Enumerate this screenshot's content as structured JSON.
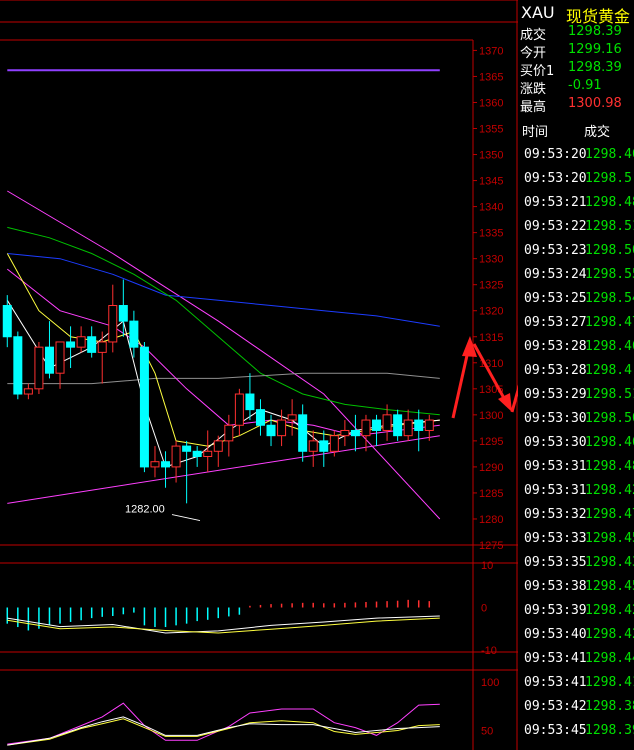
{
  "header": {
    "symbol": "XAU",
    "name": "现货黄金"
  },
  "quote": [
    {
      "label": "成交",
      "value": "1298.39",
      "color": "#00e000"
    },
    {
      "label": "今开",
      "value": "1299.16",
      "color": "#00e000"
    },
    {
      "label": "买价1",
      "value": "1298.39",
      "color": "#00e000"
    },
    {
      "label": "涨跌",
      "value": "-0.91",
      "color": "#00e000"
    },
    {
      "label": "最高",
      "value": "1300.98",
      "color": "#ff3030"
    }
  ],
  "ticks_header": {
    "time": "时间",
    "price": "成交"
  },
  "ticks": [
    {
      "time": "09:53:20",
      "price": "1298.46"
    },
    {
      "time": "09:53:20",
      "price": "1298.5"
    },
    {
      "time": "09:53:21",
      "price": "1298.48"
    },
    {
      "time": "09:53:22",
      "price": "1298.51"
    },
    {
      "time": "09:53:23",
      "price": "1298.50"
    },
    {
      "time": "09:53:24",
      "price": "1298.55"
    },
    {
      "time": "09:53:25",
      "price": "1298.54"
    },
    {
      "time": "09:53:27",
      "price": "1298.47"
    },
    {
      "time": "09:53:28",
      "price": "1298.46"
    },
    {
      "time": "09:53:28",
      "price": "1298.4"
    },
    {
      "time": "09:53:29",
      "price": "1298.51"
    },
    {
      "time": "09:53:30",
      "price": "1298.50"
    },
    {
      "time": "09:53:30",
      "price": "1298.46"
    },
    {
      "time": "09:53:31",
      "price": "1298.48"
    },
    {
      "time": "09:53:31",
      "price": "1298.42"
    },
    {
      "time": "09:53:32",
      "price": "1298.47"
    },
    {
      "time": "09:53:33",
      "price": "1298.45"
    },
    {
      "time": "09:53:35",
      "price": "1298.43"
    },
    {
      "time": "09:53:38",
      "price": "1298.45"
    },
    {
      "time": "09:53:39",
      "price": "1298.42"
    },
    {
      "time": "09:53:40",
      "price": "1298.42"
    },
    {
      "time": "09:53:41",
      "price": "1298.44"
    },
    {
      "time": "09:53:41",
      "price": "1298.41"
    },
    {
      "time": "09:53:42",
      "price": "1298.38"
    },
    {
      "time": "09:53:45",
      "price": "1298.39"
    }
  ],
  "colors": {
    "up": "#ff3030",
    "down": "#00ffff",
    "grid": "#c00000",
    "axis_text": "#c00000"
  },
  "chart_data": [
    {
      "type": "candlestick",
      "name": "price",
      "ylim": [
        1275,
        1372
      ],
      "yticks": [
        1275,
        1280,
        1285,
        1290,
        1295,
        1300,
        1305,
        1310,
        1315,
        1320,
        1325,
        1330,
        1335,
        1340,
        1345,
        1350,
        1355,
        1360,
        1365,
        1370
      ],
      "annotations": [
        {
          "text": "1282.00",
          "price": 1282
        }
      ],
      "candles": [
        [
          1321,
          1323,
          1313,
          1315
        ],
        [
          1315,
          1316,
          1303,
          1304
        ],
        [
          1304,
          1306,
          1303,
          1305
        ],
        [
          1305,
          1314,
          1304,
          1313
        ],
        [
          1313,
          1318,
          1307,
          1308
        ],
        [
          1308,
          1314,
          1305,
          1314
        ],
        [
          1314,
          1317,
          1309,
          1313
        ],
        [
          1313,
          1317,
          1312,
          1315
        ],
        [
          1315,
          1317,
          1311,
          1312
        ],
        [
          1312,
          1316,
          1306,
          1314
        ],
        [
          1314,
          1325,
          1312,
          1321
        ],
        [
          1321,
          1326,
          1315,
          1318
        ],
        [
          1318,
          1320,
          1311,
          1313
        ],
        [
          1313,
          1314,
          1289,
          1290
        ],
        [
          1290,
          1294,
          1288,
          1291
        ],
        [
          1291,
          1293,
          1286,
          1290
        ],
        [
          1290,
          1295,
          1287,
          1294
        ],
        [
          1294,
          1295,
          1283,
          1293
        ],
        [
          1293,
          1294,
          1290,
          1292
        ],
        [
          1292,
          1297,
          1289,
          1293
        ],
        [
          1293,
          1296,
          1290,
          1295
        ],
        [
          1295,
          1300,
          1292,
          1298
        ],
        [
          1298,
          1305,
          1296,
          1304
        ],
        [
          1304,
          1308,
          1299,
          1301
        ],
        [
          1301,
          1303,
          1296,
          1298
        ],
        [
          1298,
          1300,
          1294,
          1296
        ],
        [
          1296,
          1301,
          1294,
          1299
        ],
        [
          1299,
          1303,
          1296,
          1300
        ],
        [
          1300,
          1302,
          1291,
          1293
        ],
        [
          1293,
          1297,
          1290,
          1295
        ],
        [
          1295,
          1297,
          1290,
          1293
        ],
        [
          1293,
          1297,
          1292,
          1296
        ],
        [
          1296,
          1299,
          1294,
          1297
        ],
        [
          1297,
          1300,
          1293,
          1296
        ],
        [
          1296,
          1300,
          1293,
          1299
        ],
        [
          1299,
          1300,
          1294,
          1297
        ],
        [
          1297,
          1302,
          1295,
          1300
        ],
        [
          1300,
          1301,
          1295,
          1296
        ],
        [
          1296,
          1301,
          1295,
          1299
        ],
        [
          1299,
          1301,
          1293,
          1297
        ],
        [
          1297,
          1300,
          1295,
          1299
        ]
      ],
      "lines": [
        {
          "color": "#9040ff",
          "points": [
            [
              0,
              1366.2
            ],
            [
              41,
              1366.2
            ]
          ]
        },
        {
          "color": "#ff40ff",
          "points": [
            [
              0,
              1283
            ],
            [
              41,
              1296
            ]
          ]
        },
        {
          "color": "#ff40ff",
          "points": [
            [
              0,
              1343
            ],
            [
              10,
              1331
            ],
            [
              20,
              1318
            ],
            [
              30,
              1304
            ],
            [
              41,
              1280
            ]
          ]
        },
        {
          "color": "#1c3cff",
          "points": [
            [
              0,
              1331
            ],
            [
              5,
              1330
            ],
            [
              10,
              1327
            ],
            [
              15,
              1323
            ],
            [
              20,
              1322
            ],
            [
              25,
              1321
            ],
            [
              30,
              1320
            ],
            [
              35,
              1319
            ],
            [
              41,
              1317
            ]
          ]
        },
        {
          "color": "#00c000",
          "points": [
            [
              0,
              1336
            ],
            [
              4,
              1334
            ],
            [
              8,
              1331
            ],
            [
              12,
              1327
            ],
            [
              16,
              1322
            ],
            [
              20,
              1315
            ],
            [
              24,
              1308
            ],
            [
              28,
              1304
            ],
            [
              32,
              1302
            ],
            [
              36,
              1301
            ],
            [
              41,
              1300
            ]
          ]
        },
        {
          "color": "#909090",
          "points": [
            [
              0,
              1306
            ],
            [
              8,
              1306
            ],
            [
              14,
              1307
            ],
            [
              20,
              1307
            ],
            [
              28,
              1308
            ],
            [
              36,
              1308
            ],
            [
              41,
              1307
            ]
          ]
        },
        {
          "color": "#ff40ff",
          "points": [
            [
              0,
              1328
            ],
            [
              5,
              1320
            ],
            [
              10,
              1317
            ],
            [
              13,
              1313
            ],
            [
              17,
              1305
            ],
            [
              21,
              1298
            ],
            [
              25,
              1299
            ],
            [
              29,
              1298
            ],
            [
              33,
              1296
            ],
            [
              37,
              1297
            ],
            [
              41,
              1298
            ]
          ]
        },
        {
          "color": "#ffff40",
          "points": [
            [
              0,
              1331
            ],
            [
              3,
              1320
            ],
            [
              6,
              1315
            ],
            [
              9,
              1314
            ],
            [
              12,
              1316
            ],
            [
              14,
              1308
            ],
            [
              16,
              1295
            ],
            [
              19,
              1294
            ],
            [
              22,
              1296
            ],
            [
              25,
              1299
            ],
            [
              28,
              1297
            ],
            [
              31,
              1296
            ],
            [
              34,
              1297
            ],
            [
              37,
              1298
            ],
            [
              41,
              1299
            ]
          ]
        },
        {
          "color": "#ffffff",
          "points": [
            [
              0,
              1322
            ],
            [
              4,
              1309
            ],
            [
              8,
              1313
            ],
            [
              11,
              1318
            ],
            [
              13,
              1302
            ],
            [
              15,
              1290
            ],
            [
              18,
              1292
            ],
            [
              21,
              1297
            ],
            [
              24,
              1301
            ],
            [
              27,
              1299
            ],
            [
              30,
              1294
            ],
            [
              33,
              1297
            ],
            [
              36,
              1298
            ],
            [
              41,
              1299
            ]
          ]
        }
      ]
    },
    {
      "type": "bar",
      "name": "macd",
      "ylim": [
        -10,
        10
      ],
      "yticks": [
        -10,
        0,
        10
      ],
      "values": [
        -3.8,
        -4.6,
        -5.4,
        -5.0,
        -4.2,
        -3.8,
        -3.4,
        -3.0,
        -2.5,
        -2.2,
        -2.0,
        -1.6,
        -1.2,
        -4.2,
        -4.6,
        -4.6,
        -4.2,
        -3.8,
        -3.2,
        -2.9,
        -2.5,
        -2.1,
        -1.7,
        0.4,
        0.6,
        0.8,
        0.9,
        1.0,
        1.1,
        1.1,
        1.0,
        1.0,
        1.1,
        1.2,
        1.3,
        1.4,
        1.5,
        1.6,
        1.8,
        1.7,
        1.5
      ],
      "lines": [
        {
          "color": "#ffffff",
          "points": [
            [
              0,
              -2.5
            ],
            [
              5,
              -4.5
            ],
            [
              10,
              -4.0
            ],
            [
              15,
              -6.0
            ],
            [
              20,
              -5.5
            ],
            [
              25,
              -4.2
            ],
            [
              30,
              -3.4
            ],
            [
              35,
              -2.5
            ],
            [
              41,
              -2.0
            ]
          ]
        },
        {
          "color": "#ffff40",
          "points": [
            [
              0,
              -3.0
            ],
            [
              5,
              -5.0
            ],
            [
              10,
              -4.6
            ],
            [
              15,
              -5.4
            ],
            [
              20,
              -6.0
            ],
            [
              25,
              -5.1
            ],
            [
              30,
              -4.2
            ],
            [
              35,
              -3.2
            ],
            [
              41,
              -2.5
            ]
          ]
        }
      ]
    },
    {
      "type": "line",
      "name": "kdj",
      "ylim": [
        30,
        110
      ],
      "yticks": [
        50,
        100
      ],
      "lines": [
        {
          "color": "#ff40ff",
          "points": [
            [
              0,
              36
            ],
            [
              4,
              42
            ],
            [
              7,
              55
            ],
            [
              9,
              64
            ],
            [
              11,
              78
            ],
            [
              13,
              55
            ],
            [
              15,
              40
            ],
            [
              18,
              40
            ],
            [
              21,
              54
            ],
            [
              23,
              68
            ],
            [
              26,
              72
            ],
            [
              29,
              72
            ],
            [
              31,
              58
            ],
            [
              33,
              53
            ],
            [
              35,
              45
            ],
            [
              37,
              58
            ],
            [
              39,
              76
            ],
            [
              41,
              77
            ]
          ]
        },
        {
          "color": "#ffff40",
          "points": [
            [
              0,
              35
            ],
            [
              4,
              41
            ],
            [
              7,
              52
            ],
            [
              9,
              57
            ],
            [
              11,
              62
            ],
            [
              13,
              53
            ],
            [
              15,
              44
            ],
            [
              18,
              44
            ],
            [
              21,
              52
            ],
            [
              23,
              58
            ],
            [
              26,
              60
            ],
            [
              29,
              58
            ],
            [
              31,
              49
            ],
            [
              33,
              46
            ],
            [
              35,
              48
            ],
            [
              37,
              50
            ],
            [
              39,
              55
            ],
            [
              41,
              56
            ]
          ]
        },
        {
          "color": "#ffffff",
          "points": [
            [
              0,
              35
            ],
            [
              4,
              42
            ],
            [
              7,
              53
            ],
            [
              9,
              59
            ],
            [
              11,
              64
            ],
            [
              13,
              55
            ],
            [
              15,
              45
            ],
            [
              18,
              45
            ],
            [
              21,
              53
            ],
            [
              23,
              57
            ],
            [
              26,
              56
            ],
            [
              29,
              56
            ],
            [
              31,
              52
            ],
            [
              33,
              48
            ],
            [
              35,
              50
            ],
            [
              37,
              52
            ],
            [
              39,
              53
            ],
            [
              41,
              54
            ]
          ]
        }
      ]
    }
  ],
  "overlay_arrows": {
    "color": "#ff2020"
  }
}
